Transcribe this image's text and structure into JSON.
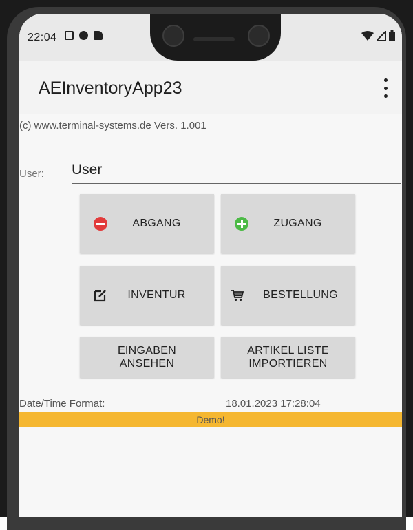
{
  "status_bar": {
    "time": "22:04",
    "left_icons": [
      "photo-icon",
      "sync-icon",
      "sd-card-icon"
    ],
    "right_icons": [
      "wifi-icon",
      "signal-icon",
      "battery-icon"
    ]
  },
  "app_bar": {
    "title": "AEInventoryApp23",
    "menu_icon": "overflow-menu-icon"
  },
  "copyright": "(c) www.terminal-systems.de Vers. 1.001",
  "user": {
    "label": "User:",
    "value": "User"
  },
  "buttons": {
    "abgang": {
      "label": "ABGANG",
      "icon": "minus-circle-icon",
      "icon_color": "#e23b3b"
    },
    "zugang": {
      "label": "ZUGANG",
      "icon": "plus-circle-icon",
      "icon_color": "#4cba46"
    },
    "inventur": {
      "label": "INVENTUR",
      "icon": "edit-icon"
    },
    "bestellung": {
      "label": "BESTELLUNG",
      "icon": "cart-icon"
    },
    "eingaben": {
      "line1": "EINGABEN",
      "line2": "ANSEHEN"
    },
    "artikel": {
      "line1": "ARTIKEL LISTE",
      "line2": "IMPORTIEREN"
    }
  },
  "date_time": {
    "label": "Date/Time Format:",
    "value": "18.01.2023 17:28:04"
  },
  "demo_banner": {
    "text": "Demo!",
    "color": "#f5b731"
  }
}
